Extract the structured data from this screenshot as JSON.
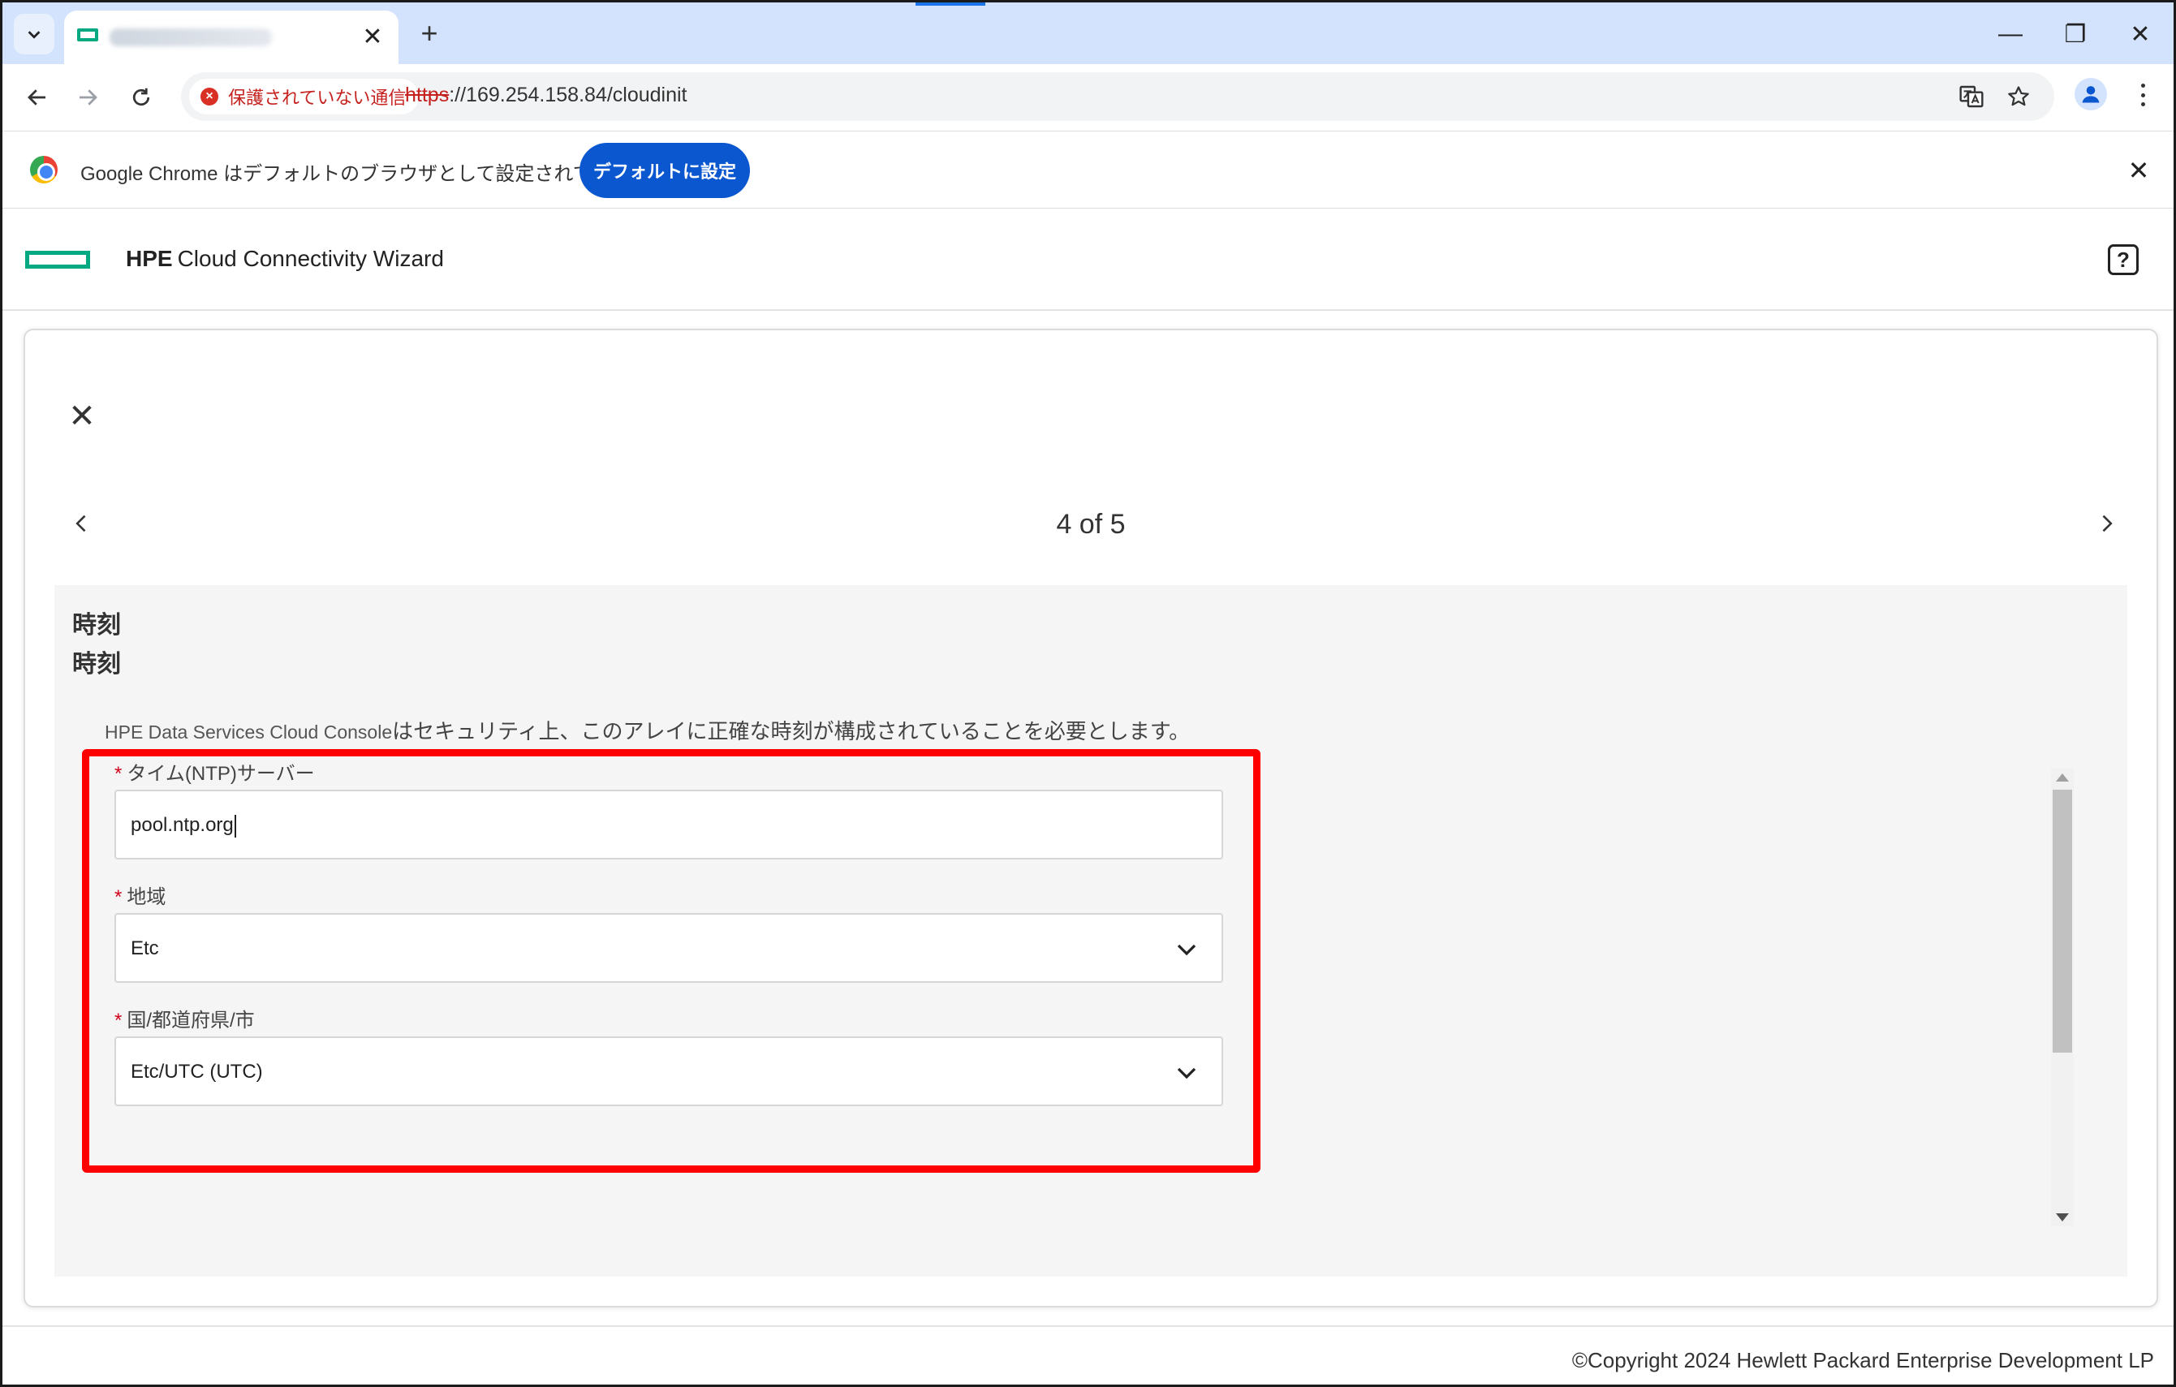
{
  "browser": {
    "tab": {
      "close_glyph": "✕"
    },
    "new_tab_glyph": "+",
    "window_controls": {
      "minimize": "—",
      "restore": "❐",
      "close": "✕"
    },
    "security_chip_label": "保護されていない通信",
    "url_scheme": "https",
    "url_rest": "://169.254.158.84/cloudinit",
    "infobar": {
      "message": "Google Chrome はデフォルトのブラウザとして設定されていません",
      "button_label": "デフォルトに設定",
      "close_glyph": "✕"
    }
  },
  "app": {
    "brand": "HPE",
    "title": "Cloud Connectivity Wizard",
    "help_glyph": "?"
  },
  "wizard": {
    "close_glyph": "✕",
    "step_indicator": "4 of 5",
    "section_title": "時刻",
    "section_subtitle": "時刻",
    "description_product": "HPE Data Services Cloud Console",
    "description_text": "はセキュリティ上、このアレイに正確な時刻が構成されていることを必要とします。",
    "fields": {
      "ntp": {
        "required_mark": "*",
        "label": "タイム(NTP)サーバー",
        "value": "pool.ntp.org"
      },
      "region": {
        "required_mark": "*",
        "label": "地域",
        "value": "Etc"
      },
      "city": {
        "required_mark": "*",
        "label": "国/都道府県/市",
        "value": "Etc/UTC (UTC)"
      }
    }
  },
  "footer": {
    "copyright": "©Copyright 2024 Hewlett Packard Enterprise Development LP"
  },
  "colors": {
    "hpe_green": "#01a982",
    "highlight_red": "#ff0000",
    "chrome_blue": "#0b57d0",
    "insecure_red": "#c5221f"
  }
}
